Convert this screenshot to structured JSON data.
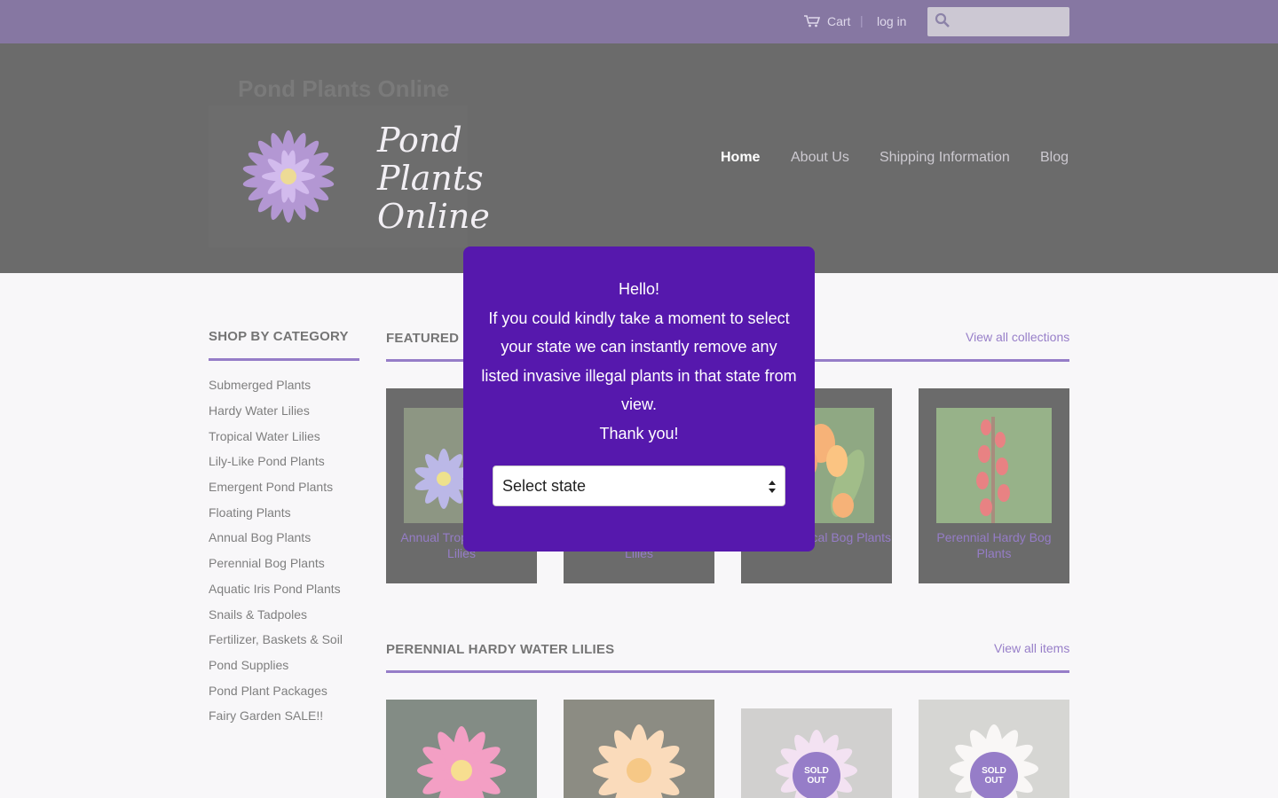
{
  "topbar": {
    "cart_label": "Cart",
    "separator": "|",
    "login_label": "log in",
    "search_placeholder": "",
    "icons": [
      "cart-icon",
      "search-icon"
    ]
  },
  "header": {
    "site_name": "Pond Plants Online",
    "logo_line1": "Pond",
    "logo_line2": "Plants",
    "logo_line3": "Online",
    "nav": [
      {
        "label": "Home",
        "active": true
      },
      {
        "label": "About Us",
        "active": false
      },
      {
        "label": "Shipping Information",
        "active": false
      },
      {
        "label": "Blog",
        "active": false
      }
    ]
  },
  "sidebar": {
    "title": "SHOP BY CATEGORY",
    "items": [
      "Submerged Plants",
      "Hardy Water Lilies",
      "Tropical Water Lilies",
      "Lily-Like Pond Plants",
      "Emergent Pond Plants",
      "Floating Plants",
      "Annual Bog Plants",
      "Perennial Bog Plants",
      "Aquatic Iris Pond Plants",
      "Snails & Tadpoles",
      "Fertilizer, Baskets & Soil",
      "Pond Supplies",
      "Pond Plant Packages",
      "Fairy Garden SALE!!"
    ]
  },
  "featured": {
    "title": "FEATURED",
    "link": "View all collections",
    "cards": [
      {
        "label": "Annual Tropical Water Lilies"
      },
      {
        "label": "Perennial Hardy Water Lilies"
      },
      {
        "label": "Annual Tropical Bog Plants"
      },
      {
        "label": "Perennial Hardy Bog Plants"
      }
    ]
  },
  "lilies": {
    "title": "PERENNIAL HARDY WATER LILIES",
    "link": "View all items",
    "sold_out_line1": "SOLD",
    "sold_out_line2": "OUT"
  },
  "modal": {
    "greeting": "Hello!",
    "message": "If you could kindly take a moment to select your state we can instantly remove any listed invasive illegal plants in that state from view.",
    "thanks": "Thank you!",
    "select_value": "Select state"
  },
  "colors": {
    "topbar": "#2f1660",
    "accent": "#4a1fa0",
    "modal": "#5618ad"
  }
}
